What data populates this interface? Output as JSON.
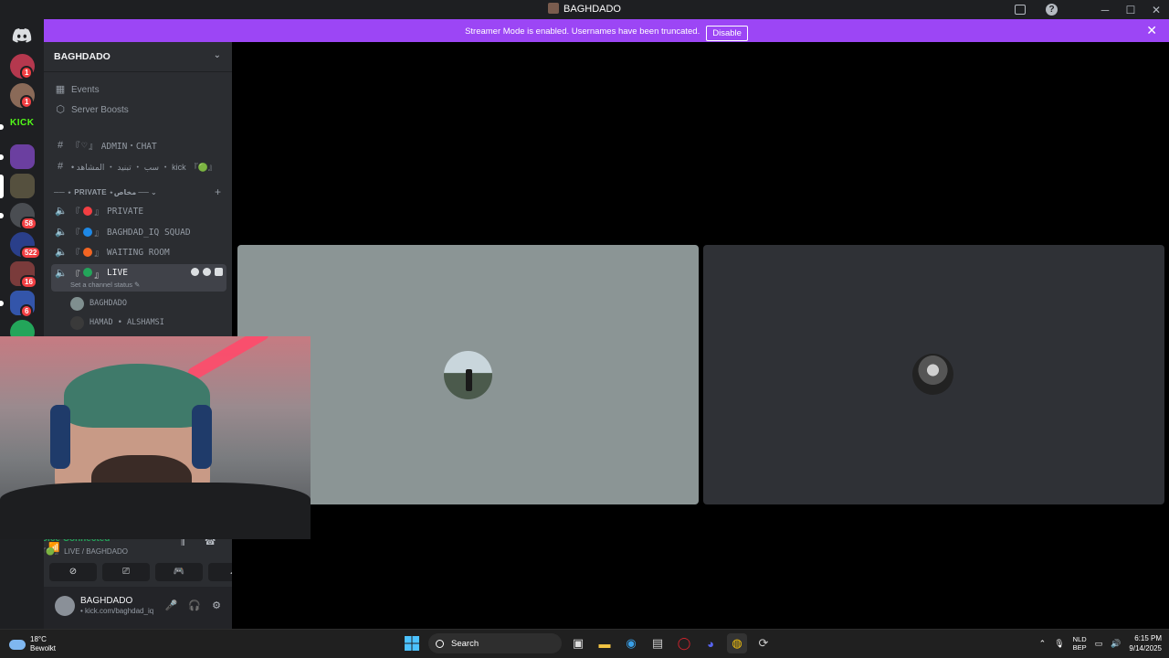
{
  "window": {
    "title": "BAGHDADO"
  },
  "banner": {
    "message": "Streamer Mode is enabled. Usernames have been truncated.",
    "disable_label": "Disable",
    "color": "#9c46f5"
  },
  "rail": {
    "badges": [
      "1",
      "1",
      "58",
      "522",
      "16",
      "6"
    ],
    "kick_label": "KICK"
  },
  "server": {
    "name": "BAGHDADO",
    "nav": [
      {
        "icon": "calendar-icon",
        "label": "Events"
      },
      {
        "icon": "boost-icon",
        "label": "Server Boosts"
      }
    ],
    "text_channels": [
      {
        "icon": "hash-icon",
        "prefix": "『",
        "mid": "』",
        "label": "ADMIN・CHAT",
        "dot": ""
      },
      {
        "icon": "hash-icon",
        "prefix": "• سب ・ تبنيد ・ المشاهد ・ kick",
        "mid": "",
        "label": "『🟢』",
        "dot": ""
      }
    ],
    "category": "── ⋆ PRIVATE ⋆مخاص ──",
    "voice_channels": [
      {
        "label": "PRIVATE",
        "dot_color": "#f23f43"
      },
      {
        "label": "BAGHDAD_IQ SQUAD",
        "dot_color": "#1e88e5"
      },
      {
        "label": "WAITING ROOM",
        "dot_color": "#f26522"
      },
      {
        "label": "LIVE",
        "dot_color": "#23a55a"
      }
    ],
    "channel_status_hint": "Set a channel status ✎",
    "members": [
      "BAGHDADO",
      "HAMAD • ALSHAMSI"
    ],
    "bracket_open": "『",
    "bracket_close": "』"
  },
  "voice": {
    "status": "Voice Connected",
    "channel": "『🟢』 LIVE / BAGHDADO"
  },
  "user": {
    "name": "BAGHDADO",
    "status": "• kick.com/baghdad_iq"
  },
  "stage": {
    "tiles": [
      {
        "bg": "#8b9595"
      },
      {
        "bg": "#2f3136"
      }
    ]
  },
  "taskbar": {
    "weather_temp": "18°C",
    "weather_desc": "Bewolkt",
    "search_placeholder": "Search",
    "lang_top": "NLD",
    "lang_bottom": "BEP",
    "time": "6:15 PM",
    "date": "9/14/2025"
  }
}
